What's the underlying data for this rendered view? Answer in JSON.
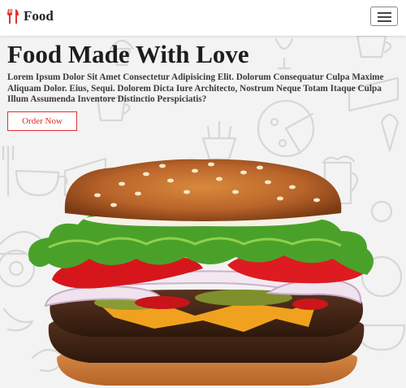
{
  "navbar": {
    "brand_text": "Food",
    "brand_icon": "utensils-icon",
    "menu_icon": "hamburger-menu-icon"
  },
  "hero": {
    "title": "Food Made With Love",
    "description": "Lorem Ipsum Dolor Sit Amet Consectetur Adipisicing Elit. Dolorum Consequatur Culpa Maxime Aliquam Dolor. Eius, Sequi. Dolorem Dicta Iure Architecto, Nostrum Neque Totam Itaque Culpa Illum Assumenda Inventore Distinctio Perspiciatis?",
    "cta_label": "Order Now",
    "image": "burger-image"
  },
  "colors": {
    "accent": "#e23030",
    "background": "#f3f3f3",
    "navbar": "#ffffff"
  }
}
